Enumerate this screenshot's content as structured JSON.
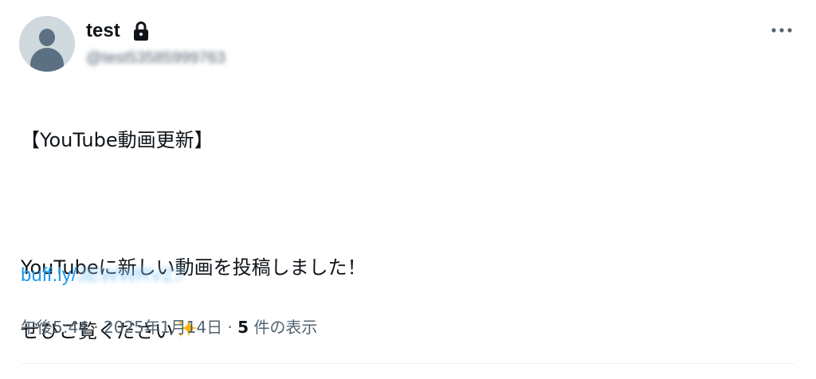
{
  "user": {
    "display_name": "test",
    "handle": "@test53585999763"
  },
  "tweet": {
    "lines": [
      "【YouTube動画更新】",
      "",
      "YouTubeに新しい動画を投稿しました！",
      "ぜひご覧ください"
    ],
    "link_visible": "buff.ly/",
    "link_hidden": "3EWWRVZ7"
  },
  "meta": {
    "time": "午後5:44",
    "separator1": " · ",
    "date": "2025年1月14日",
    "separator2": " · ",
    "view_count": "5",
    "view_label": " 件の表示"
  },
  "icons": {
    "lock": "lock-icon",
    "more": "more-horizontal-icon",
    "sparkle": "sparkles-emoji"
  },
  "colors": {
    "link": "#1d9bf0",
    "secondary_text": "#536471",
    "primary_text": "#0f1419"
  }
}
